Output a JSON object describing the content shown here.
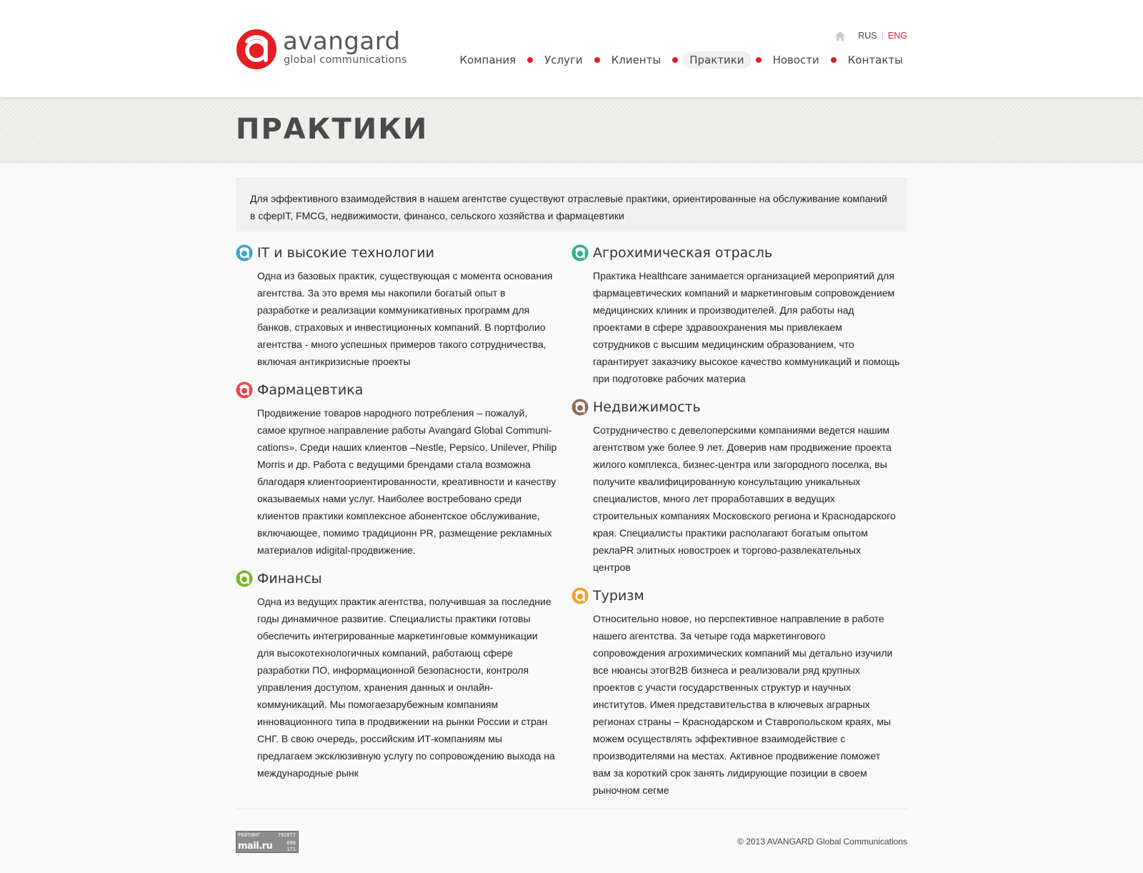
{
  "colors": {
    "accent": "#e31e24",
    "it": "#3aa6c7",
    "pharma": "#e8474b",
    "finance": "#7bb42a",
    "agro": "#2fb28c",
    "realty": "#8c6e5d",
    "tourism": "#f0a02a"
  },
  "header": {
    "logo_name": "avangard",
    "logo_tagline": "global communications",
    "lang": {
      "rus": "RUS",
      "sep": "|",
      "eng": "ENG"
    },
    "nav": [
      "Компания",
      "Услуги",
      "Клиенты",
      "Практики",
      "Новости",
      "Контакты"
    ],
    "nav_active": "Практики"
  },
  "page": {
    "title": "ПРАКТИКИ",
    "intro": "Для эффективного взаимодействия в нашем агентстве существуют отраслевые практики, ориентированные на обслуживание компаний в сферIT, FMCG, недвижимости, финансо, сельского хозяйства и фармацевтики"
  },
  "practices_left": [
    {
      "title": "IT и высокие технологии",
      "icon": "it-practice-icon",
      "text": "Одна из базовых практик, существующая с момента основания агентства. За это время мы накопили богатый опыт в разработке и реализации коммуникативных программ для банков, страховых и инвестиционных компаний. В портфолио агентства - много успешных примеров такого сотрудничества, включая антикризисные проекты"
    },
    {
      "title": "Фармацевтика",
      "icon": "pharma-practice-icon",
      "text": "Продвижение товаров народного потребления – пожалуй, самое крупное направление работы Avangard Global Communi-cations». Среди наших клиентов –Nestle, Pepsico, Unilever, Philip Morris и др. Работа с ведущими брендами стала возможна благодаря клиентоориентированности, креативности и качеству оказываемых нами услуг. Наиболее востребовано среди клиентов практики комплексное абонентское обслуживание, включающее, помимо традиционн PR, размещение рекламных материалов иdigital-продвижение."
    },
    {
      "title": "Финансы",
      "icon": "finance-practice-icon",
      "text": "Одна из ведущих практик агентства, получившая за последние годы динамичное развитие. Специалисты практики готовы обеспечить интегрированные маркетинговые коммуникации для высокотехнологичных компаний, работающ сфере разработки ПО, информационной безопасности, контроля управления доступом, хранения данных и онлайн-коммуникаций. Мы помогаезарубежным компаниям инновационного типа в продвижении на рынки России и стран СНГ. В свою очередь, российским ИТ-компаниям мы предлагаем эксклюзивную услугу по сопровождению выхода на международные рынк"
    }
  ],
  "practices_right": [
    {
      "title": "Агрохимическая отрасль",
      "icon": "agro-practice-icon",
      "text": "Практика Healthcare занимается организацией мероприятий для фармацевтических компаний и маркетинговым сопровождением медицинских клиник и производителей. Для работы над проектами в сфере здравоохранения мы привлекаем сотрудников с высшим медицинским образованием, что гарантирует заказчику высокое качество коммуникаций и помощь при подготовке рабочих материа"
    },
    {
      "title": "Недвижимость",
      "icon": "realty-practice-icon",
      "text": "Сотрудничество с девелоперскими компаниями ведется нашим агентством уже более 9 лет. Доверив нам продвижение проекта жилого комплекса, бизнес-центра или загородного поселка, вы получите квалифицированную консультацию уникальных специалистов, много лет проработавших в ведущих строительных компаниях Московского региона и Краснодарского края. Специалисты практики располагают богатым опытом реклаPR элитных новостроек и торгово-развлекательных центров"
    },
    {
      "title": "Туризм",
      "icon": "tourism-practice-icon",
      "text": "Относительно новое, но перспективное направление в работе нашего агентства. За четыре года маркетингового сопровождения агрохимических компаний мы детально изучили все нюансы этогB2B бизнеса и реализовали ряд крупных проектов с участи государственных структур и научных институтов. Имея представительства в ключевых аграрных регионах страны – Краснодарском и Ставропольском краях, мы можем осуществлять эффективное взаимодействие с производителями на местах. Активное продвижение поможет вам за короткий срок занять лидирующие позиции в своем рыночном сегме"
    }
  ],
  "footer": {
    "counter": {
      "label": "РЕЙТИНГ",
      "brand": "mail.ru",
      "v1": "792877",
      "v2": "698",
      "v3": "171"
    },
    "copyright": "© 2013 AVANGARD Global Communications"
  }
}
